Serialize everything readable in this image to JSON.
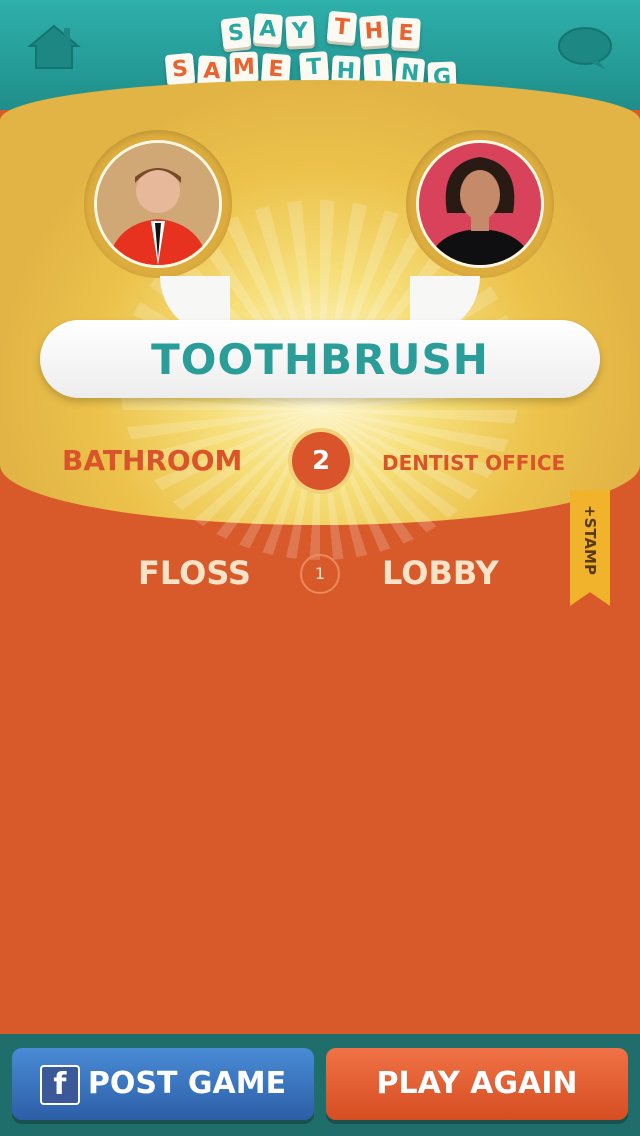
{
  "header": {
    "logo_line1": [
      "S",
      "A",
      "Y",
      "T",
      "H",
      "E"
    ],
    "logo_line2": [
      "S",
      "A",
      "M",
      "E",
      "T",
      "H",
      "I",
      "N",
      "G"
    ]
  },
  "players": {
    "left_avatar": "player-photo-man-red-suit",
    "right_avatar": "player-photo-woman-black-top"
  },
  "current_round": {
    "word": "TOOTHBRUSH",
    "left_word": "BATHROOM",
    "number": "2",
    "right_word": "DENTIST OFFICE"
  },
  "previous_round": {
    "left_word": "FLOSS",
    "number": "1",
    "right_word": "LOBBY"
  },
  "stamp": {
    "label": "+STAMP"
  },
  "buttons": {
    "post_game": "POST GAME",
    "play_again": "PLAY AGAIN",
    "facebook_glyph": "f"
  },
  "colors": {
    "teal": "#2fb0ab",
    "orange": "#d85a2a",
    "yellow": "#ecc24b",
    "blue_button": "#2c5fa7"
  },
  "icons": {
    "home": "home-icon",
    "chat": "chat-bubble-icon",
    "facebook": "facebook-icon"
  }
}
